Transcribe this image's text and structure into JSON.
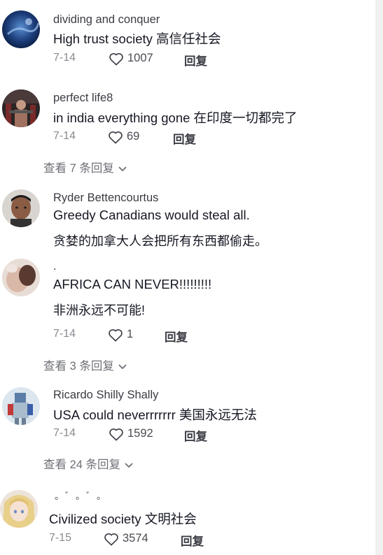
{
  "comments": [
    {
      "username": "dividing and conquer",
      "text": "High trust society  高信任社会",
      "date": "7-14",
      "likes": "1007",
      "reply_label": "回复"
    },
    {
      "username": "perfect life8",
      "text": "in india everything gone  在印度一切都完了",
      "date": "7-14",
      "likes": "69",
      "reply_label": "回复",
      "view_replies": "查看 7 条回复"
    },
    {
      "username": "Ryder Bettencourtus",
      "text": "Greedy Canadians would steal all.",
      "translation": "贪婪的加拿大人会把所有东西都偷走。"
    },
    {
      "username": ".",
      "text": "AFRICA CAN NEVER!!!!!!!!!",
      "translation": "非洲永远不可能!",
      "date": "7-14",
      "likes": "1",
      "reply_label": "回复",
      "view_replies": "查看 3 条回复"
    },
    {
      "username": "Ricardo Shilly Shally",
      "text": "USA could neverrrrrrr  美国永远无法",
      "date": "7-14",
      "likes": "1592",
      "reply_label": "回复",
      "view_replies": "查看 24 条回复"
    },
    {
      "username": "。゛。゛。",
      "text": "Civilized society  文明社会",
      "date": "7-15",
      "likes": "3574",
      "reply_label": "回复"
    }
  ],
  "icons": {
    "like": "heart-outline-icon",
    "expand": "chevron-down-icon"
  },
  "colors": {
    "primary_text": "#161823",
    "secondary_text": "#8a8b91",
    "background": "#ffffff"
  }
}
